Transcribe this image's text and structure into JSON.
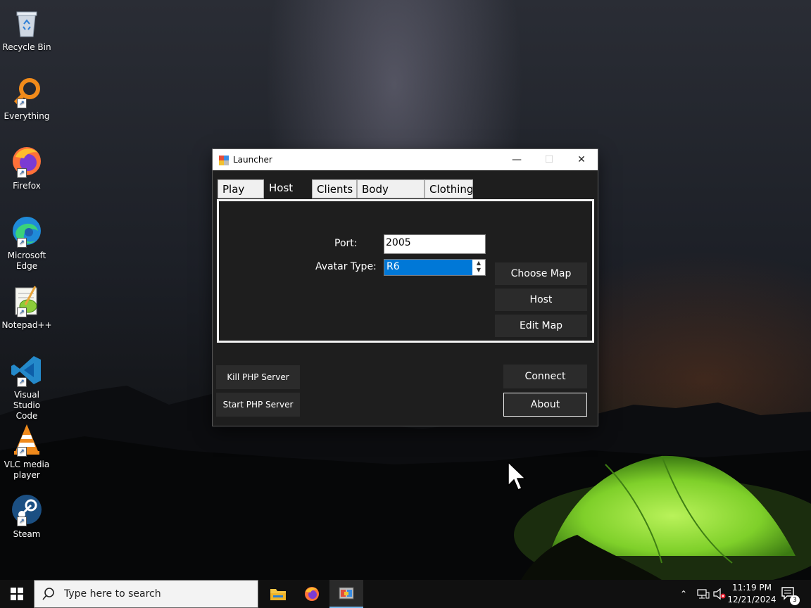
{
  "desktop": {
    "icons": [
      {
        "label": "Recycle Bin",
        "icon": "recycle-bin-icon"
      },
      {
        "label": "Everything",
        "icon": "everything-search-icon"
      },
      {
        "label": "Firefox",
        "icon": "firefox-icon"
      },
      {
        "label": "Microsoft Edge",
        "icon": "edge-icon"
      },
      {
        "label": "Notepad++",
        "icon": "notepad-plus-plus-icon"
      },
      {
        "label": "Visual Studio Code",
        "icon": "vscode-icon"
      },
      {
        "label": "VLC media player",
        "icon": "vlc-icon"
      },
      {
        "label": "Steam",
        "icon": "steam-icon"
      }
    ]
  },
  "window": {
    "title": "Launcher",
    "tabs": [
      "Play",
      "Host",
      "Clients",
      "Body Colors",
      "Clothing"
    ],
    "active_tab": "Host",
    "host": {
      "port_label": "Port:",
      "port_value": "2005",
      "avatar_label": "Avatar Type:",
      "avatar_value": "R6",
      "choose_map": "Choose Map",
      "host": "Host",
      "edit_map": "Edit Map"
    },
    "footer": {
      "kill_php": "Kill PHP Server",
      "start_php": "Start PHP Server",
      "connect": "Connect",
      "about": "About"
    }
  },
  "taskbar": {
    "search_placeholder": "Type here to search",
    "time": "11:19 PM",
    "date": "12/21/2024",
    "notification_count": "3"
  },
  "colors": {
    "accent": "#0078d7",
    "window_bg": "#1e1e1e",
    "button_bg": "#2b2b2b",
    "taskbar_bg": "#101010"
  }
}
